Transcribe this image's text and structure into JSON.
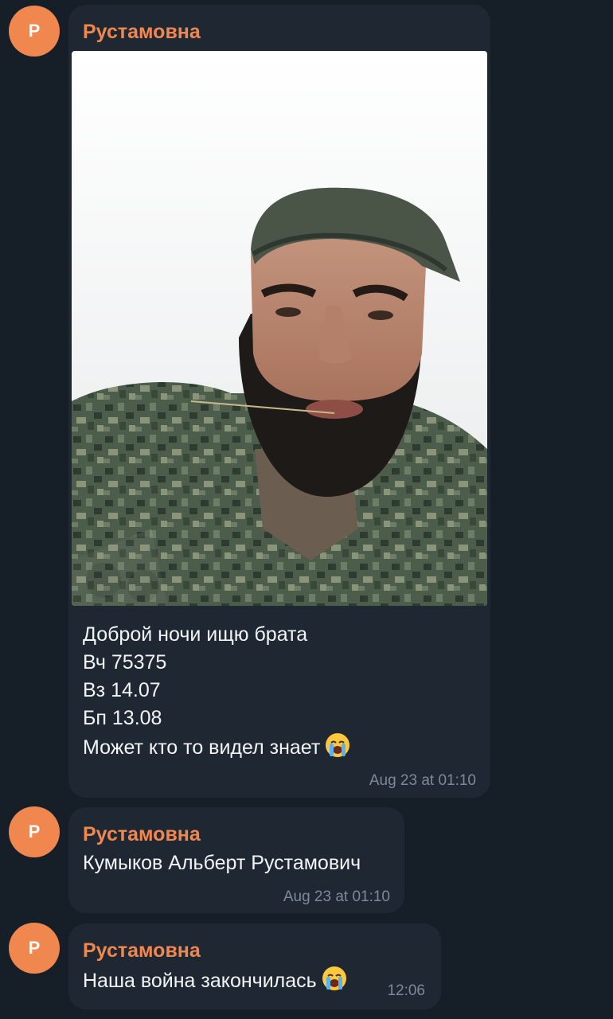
{
  "colors": {
    "background": "#161f28",
    "bubble": "#1f2832",
    "avatar": "#f0874f",
    "sender_name": "#f0874f",
    "timestamp": "#7c8a97",
    "text": "#f2f4f6"
  },
  "messages": [
    {
      "avatar_initial": "P",
      "sender": "Рустамовна",
      "has_photo": true,
      "photo_icon": "selfie-photo",
      "lines": [
        "Доброй ночи ищю брата",
        "Вч 75375",
        "Вз 14.07",
        "Бп 13.08",
        "Может кто то видел знает"
      ],
      "trailing_emoji": "crying-face-icon",
      "time": "Aug 23 at 01:10"
    },
    {
      "avatar_initial": "P",
      "sender": "Рустамовна",
      "lines": [
        "Кумыков Альберт Рустамович"
      ],
      "time": "Aug 23 at 01:10"
    },
    {
      "avatar_initial": "P",
      "sender": "Рустамовна",
      "lines": [
        "Наша война закончилась"
      ],
      "trailing_emoji": "crying-face-icon",
      "time": "12:06"
    }
  ]
}
